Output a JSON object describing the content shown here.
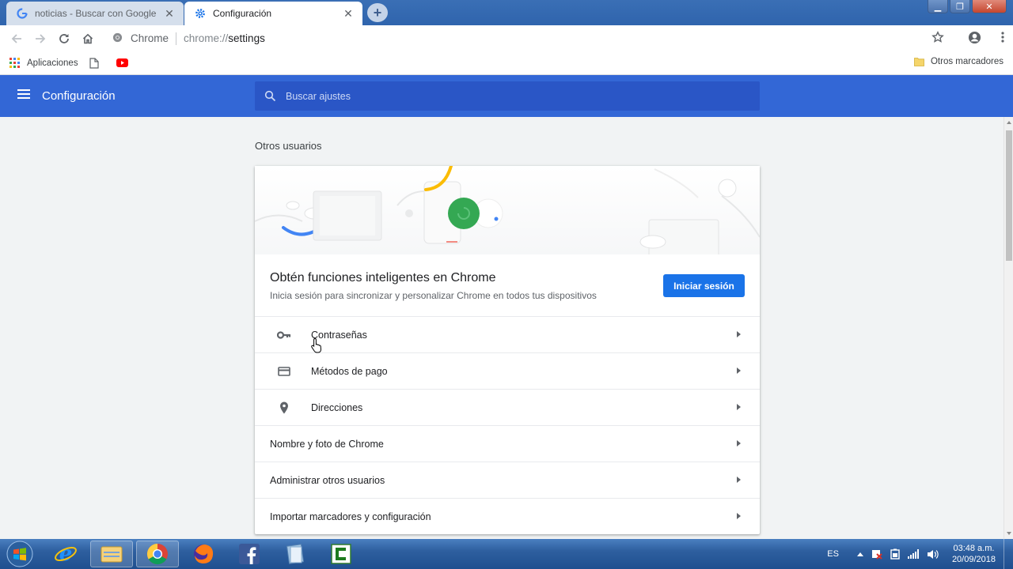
{
  "tabs": [
    {
      "title": "noticias - Buscar con Google",
      "icon": "google-g-icon",
      "active": false
    },
    {
      "title": "Configuración",
      "icon": "gear-icon",
      "active": true
    }
  ],
  "omnibox": {
    "site_label": "Chrome",
    "url_scheme": "chrome://",
    "url_path": "settings"
  },
  "bookmarks": {
    "items": [
      {
        "label": "Aplicaciones",
        "icon": "apps-grid-icon"
      },
      {
        "label": "",
        "icon": "page-icon"
      },
      {
        "label": "",
        "icon": "youtube-icon"
      }
    ],
    "other": "Otros marcadores"
  },
  "settings": {
    "title": "Configuración",
    "search_placeholder": "Buscar ajustes",
    "section_title": "Otros usuarios",
    "promo": {
      "title": "Obtén funciones inteligentes en Chrome",
      "subtitle": "Inicia sesión para sincronizar y personalizar Chrome en todos tus dispositivos",
      "button": "Iniciar sesión"
    },
    "rows": [
      {
        "label": "Contraseñas",
        "icon": "key-icon"
      },
      {
        "label": "Métodos de pago",
        "icon": "credit-card-icon"
      },
      {
        "label": "Direcciones",
        "icon": "location-pin-icon"
      },
      {
        "label": "Nombre y foto de Chrome",
        "icon": ""
      },
      {
        "label": "Administrar otros usuarios",
        "icon": ""
      },
      {
        "label": "Importar marcadores y configuración",
        "icon": ""
      }
    ]
  },
  "taskbar": {
    "apps": [
      "internet-explorer-icon",
      "file-explorer-icon",
      "chrome-icon",
      "firefox-icon",
      "facebook-icon",
      "notebook-icon",
      "camtasia-icon"
    ],
    "language": "ES",
    "time": "03:48 a.m.",
    "date": "20/09/2018"
  },
  "colors": {
    "header_blue": "#3367d6",
    "search_blue": "#2a56c6",
    "button_blue": "#1a73e8",
    "taskbar_blue": "#2e5f9f"
  }
}
